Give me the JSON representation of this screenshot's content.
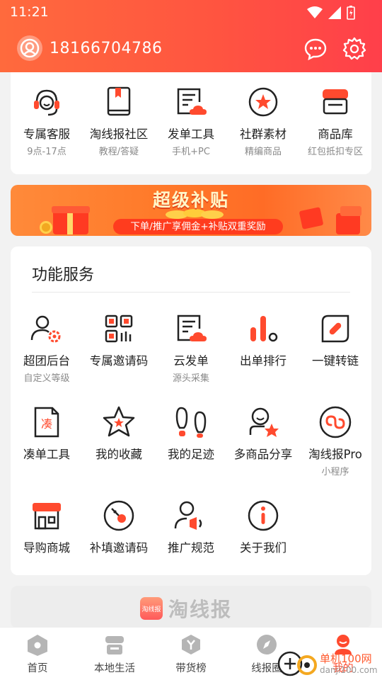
{
  "status_bar": {
    "time": "11:21"
  },
  "header": {
    "phone": "18166704786"
  },
  "top_grid": [
    {
      "label": "专属客服",
      "sub": "9点-17点",
      "icon": "headset-icon"
    },
    {
      "label": "淘线报社区",
      "sub": "教程/答疑",
      "icon": "book-icon"
    },
    {
      "label": "发单工具",
      "sub": "手机+PC",
      "icon": "document-cloud-icon"
    },
    {
      "label": "社群素材",
      "sub": "精编商品",
      "icon": "star-circle-icon"
    },
    {
      "label": "商品库",
      "sub": "红包抵扣专区",
      "icon": "store-icon"
    }
  ],
  "banner": {
    "title": "超级补贴",
    "subtitle": "下单/推广享佣金+补贴双重奖励"
  },
  "function_services": {
    "title": "功能服务",
    "items": [
      {
        "label": "超团后台",
        "sub": "自定义等级",
        "icon": "user-settings-icon"
      },
      {
        "label": "专属邀请码",
        "sub": "",
        "icon": "qr-code-icon"
      },
      {
        "label": "云发单",
        "sub": "源头采集",
        "icon": "document-cloud-icon"
      },
      {
        "label": "出单排行",
        "sub": "",
        "icon": "ranking-icon"
      },
      {
        "label": "一键转链",
        "sub": "",
        "icon": "link-icon"
      },
      {
        "label": "凑单工具",
        "sub": "",
        "icon": "file-tool-icon"
      },
      {
        "label": "我的收藏",
        "sub": "",
        "icon": "star-icon"
      },
      {
        "label": "我的足迹",
        "sub": "",
        "icon": "footprint-icon"
      },
      {
        "label": "多商品分享",
        "sub": "",
        "icon": "share-user-icon"
      },
      {
        "label": "淘线报Pro",
        "sub": "小程序",
        "icon": "miniprogram-icon"
      },
      {
        "label": "导购商城",
        "sub": "",
        "icon": "shop-icon"
      },
      {
        "label": "补填邀请码",
        "sub": "",
        "icon": "key-icon"
      },
      {
        "label": "推广规范",
        "sub": "",
        "icon": "megaphone-user-icon"
      },
      {
        "label": "关于我们",
        "sub": "",
        "icon": "info-icon"
      }
    ]
  },
  "footer_logo": {
    "badge": "淘线报",
    "text": "淘线报"
  },
  "bottom_nav": [
    {
      "label": "首页",
      "icon": "home-icon"
    },
    {
      "label": "本地生活",
      "icon": "local-life-icon"
    },
    {
      "label": "带货榜",
      "icon": "ranking-badge-icon"
    },
    {
      "label": "线报圈",
      "icon": "compass-icon"
    },
    {
      "label": "我的",
      "icon": "profile-icon"
    }
  ],
  "watermark": {
    "text": "单机100网",
    "url": "danji100.com"
  },
  "colors": {
    "accent": "#ff4a2e",
    "header_start": "#ff6a3d",
    "header_end": "#ff3f4a"
  }
}
